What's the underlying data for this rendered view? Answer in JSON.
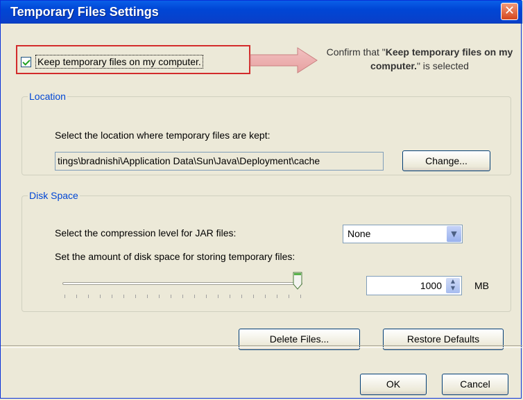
{
  "window": {
    "title": "Temporary Files Settings"
  },
  "keep": {
    "label": "Keep temporary files on my computer.",
    "checked": true
  },
  "callout": {
    "prefix": "Confirm that \"",
    "bold": "Keep temporary files on my computer.",
    "suffix": "\" is selected"
  },
  "location": {
    "legend": "Location",
    "instruction": "Select the location where temporary files are kept:",
    "path": "tings\\bradnishi\\Application Data\\Sun\\Java\\Deployment\\cache",
    "change_label": "Change..."
  },
  "disk": {
    "legend": "Disk Space",
    "compression_label": "Select the compression level for JAR files:",
    "compression_value": "None",
    "space_label": "Set the amount of disk space for storing temporary files:",
    "space_value": "1000",
    "unit": "MB",
    "slider_fraction": 1.0
  },
  "buttons": {
    "delete": "Delete Files...",
    "restore": "Restore Defaults",
    "ok": "OK",
    "cancel": "Cancel"
  },
  "colors": {
    "accent": "#0046d5",
    "highlight": "#d32b2b"
  }
}
